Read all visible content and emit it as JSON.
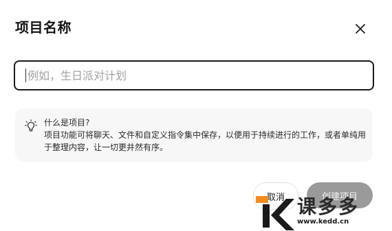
{
  "dialog": {
    "title": "项目名称",
    "close_icon": "close-icon"
  },
  "name_input": {
    "placeholder": "例如，生日派对计划",
    "value": ""
  },
  "info": {
    "icon": "lightbulb-icon",
    "title": "什么是项目?",
    "body": "项目功能可将聊天、文件和自定义指令集中保存，以便用于持续进行的工作，或者单纯用于整理内容，让一切更井然有序。"
  },
  "buttons": {
    "cancel_label": "取消",
    "create_label": "创建项目"
  },
  "watermark": {
    "name": "课多多",
    "url": "www.kedd.cn",
    "accent": "#f28c1e"
  }
}
